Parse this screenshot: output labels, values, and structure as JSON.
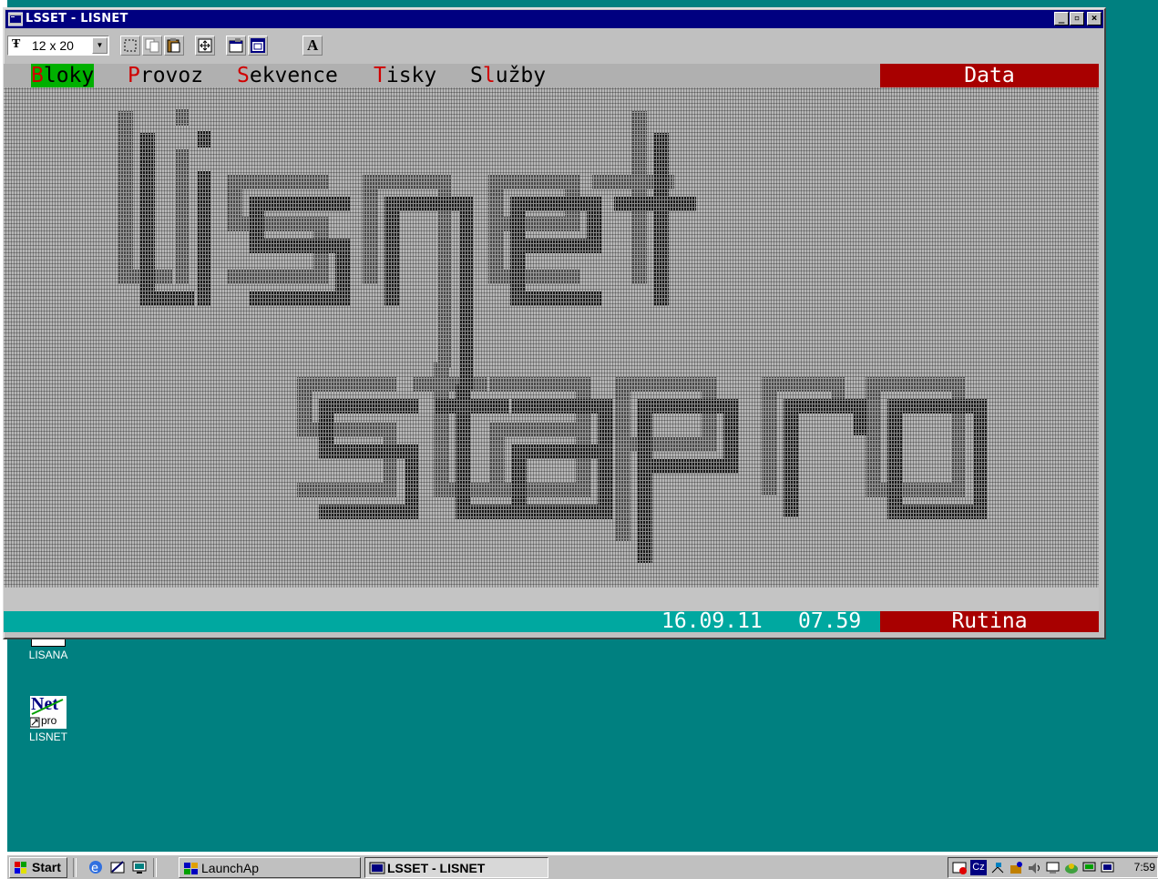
{
  "window": {
    "title": "LSSET - LISNET",
    "caption_buttons": {
      "minimize": "_",
      "maximize": "▫",
      "close": "×"
    }
  },
  "toolbar": {
    "font_size": "12 x 20",
    "font_icon": "Ŧ",
    "bold_a": "A",
    "icons": [
      "mark-icon",
      "copy-icon",
      "paste-icon",
      "fullscreen-icon",
      "properties-icon",
      "background-icon",
      "font-icon"
    ]
  },
  "console": {
    "menu": [
      {
        "hot": "B",
        "rest": "loky"
      },
      {
        "hot": "P",
        "rest": "rovoz"
      },
      {
        "hot": "S",
        "rest": "ekvence"
      },
      {
        "hot": "T",
        "rest": "isky"
      },
      {
        "pre": "S",
        "hot": "l",
        "rest": "užby"
      }
    ],
    "menu_right": "Data",
    "status": {
      "date": "16.09.11",
      "time": "07.59",
      "mode": "Rutina"
    },
    "logo_words": [
      "lisnet",
      "stapro"
    ]
  },
  "desktop": {
    "icons": [
      {
        "label": "LISANA"
      },
      {
        "label": "LISNET",
        "badge_top": "Net",
        "badge_bottom": "pro"
      }
    ]
  },
  "taskbar": {
    "start": "Start",
    "tasks": [
      "LaunchAp",
      "LSSET - LISNET"
    ],
    "tray_lang": "Cz",
    "clock": "7:59"
  },
  "colors": {
    "desktop": "#008080",
    "titlebar": "#000080",
    "menu_hot": "#d00000",
    "menu_selected": "#00b000",
    "panel_red": "#a80000",
    "status_teal": "#00a8a0"
  }
}
